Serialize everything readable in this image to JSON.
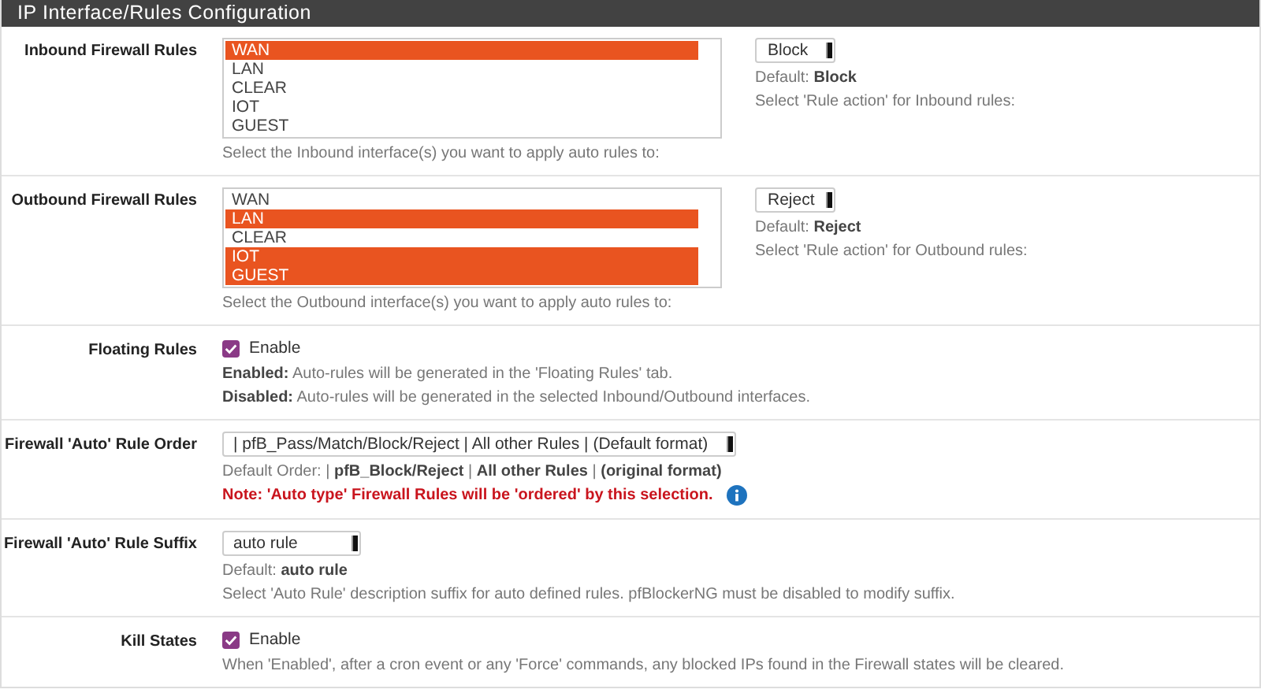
{
  "panel": {
    "title": "IP Interface/Rules Configuration"
  },
  "rows": [
    {
      "kind": "listbox",
      "label": "Inbound Firewall Rules",
      "options": [
        {
          "label": "WAN",
          "selected": true
        },
        {
          "label": "LAN",
          "selected": false
        },
        {
          "label": "CLEAR",
          "selected": false
        },
        {
          "label": "IOT",
          "selected": false
        },
        {
          "label": "GUEST",
          "selected": false
        }
      ],
      "help": [
        "Select the Inbound interface(s) you want to apply auto rules to:"
      ],
      "side_select": {
        "value": "Block",
        "help": [
          "Default: **Block**",
          "Select 'Rule action' for Inbound rules:"
        ]
      }
    },
    {
      "kind": "listbox",
      "label": "Outbound Firewall Rules",
      "options": [
        {
          "label": "WAN",
          "selected": false
        },
        {
          "label": "LAN",
          "selected": true
        },
        {
          "label": "CLEAR",
          "selected": false
        },
        {
          "label": "IOT",
          "selected": true
        },
        {
          "label": "GUEST",
          "selected": true
        }
      ],
      "help": [
        "Select the Outbound interface(s) you want to apply auto rules to:"
      ],
      "side_select": {
        "value": "Reject",
        "help": [
          "Default: **Reject**",
          "Select 'Rule action' for Outbound rules:"
        ]
      }
    },
    {
      "kind": "checkbox",
      "label": "Floating Rules",
      "checkbox": {
        "label": "Enable",
        "checked": true
      },
      "help": [
        "**Enabled:** Auto-rules will be generated in the 'Floating Rules' tab.",
        "**Disabled:** Auto-rules will be generated in the selected Inbound/Outbound interfaces."
      ]
    },
    {
      "kind": "select",
      "label": "Firewall 'Auto' Rule Order",
      "select": {
        "value": "| pfB_Pass/Match/Block/Reject | All other Rules | (Default format)"
      },
      "help": [
        "Default Order: | **pfB_Block/Reject** | **All other Rules** | **(original format)**"
      ],
      "note": "Note: 'Auto type' Firewall Rules will be 'ordered' by this selection."
    },
    {
      "kind": "select",
      "label": "Firewall 'Auto' Rule Suffix",
      "select": {
        "value": "auto rule"
      },
      "help": [
        "Default: **auto rule**",
        "Select 'Auto Rule' description suffix for auto defined rules. pfBlockerNG must be disabled to modify suffix."
      ]
    },
    {
      "kind": "checkbox",
      "label": "Kill States",
      "checkbox": {
        "label": "Enable",
        "checked": true
      },
      "help": [
        "When 'Enabled', after a cron event or any 'Force' commands, any blocked IPs found in the Firewall states will be cleared."
      ]
    }
  ]
}
